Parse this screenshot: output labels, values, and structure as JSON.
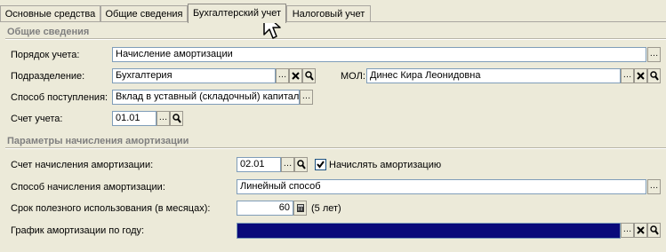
{
  "tabs": [
    {
      "label": "Основные средства"
    },
    {
      "label": "Общие сведения"
    },
    {
      "label": "Бухгалтерский учет"
    },
    {
      "label": "Налоговый учет"
    }
  ],
  "active_tab": "Бухгалтерский учет",
  "section_general": {
    "title": "Общие сведения",
    "order_label": "Порядок учета:",
    "order_value": "Начисление амортизации",
    "department_label": "Подразделение:",
    "department_value": "Бухгалтерия",
    "mol_label": "МОЛ:",
    "mol_value": "Динес Кира Леонидовна",
    "receipt_label": "Способ поступления:",
    "receipt_value": "Вклад в уставный (складочный) капитал",
    "account_label": "Счет учета:",
    "account_value": "01.01"
  },
  "section_depreciation": {
    "title": "Параметры начисления амортизации",
    "dep_account_label": "Счет начисления амортизации:",
    "dep_account_value": "02.01",
    "accrue_checkbox_label": "Начислять амортизацию",
    "accrue_checked": true,
    "method_label": "Способ начисления амортизации:",
    "method_value": "Линейный способ",
    "useful_life_label": "Срок полезного использования (в месяцах):",
    "useful_life_value": "60",
    "useful_life_years": "(5 лет)",
    "schedule_label": "График амортизации по году:",
    "schedule_value": ""
  },
  "icons": {
    "select": "ellipsis-icon",
    "clear": "clear-x-icon",
    "open": "magnifier-icon",
    "calculator": "calculator-icon",
    "checkmark": "checkmark-icon",
    "cursor": "mouse-pointer-icon"
  },
  "colors": {
    "panel_bg": "#ecead9",
    "field_border": "#7f9db9",
    "section_title": "#7f7f7f",
    "schedule_field": "#0a0a7a"
  }
}
